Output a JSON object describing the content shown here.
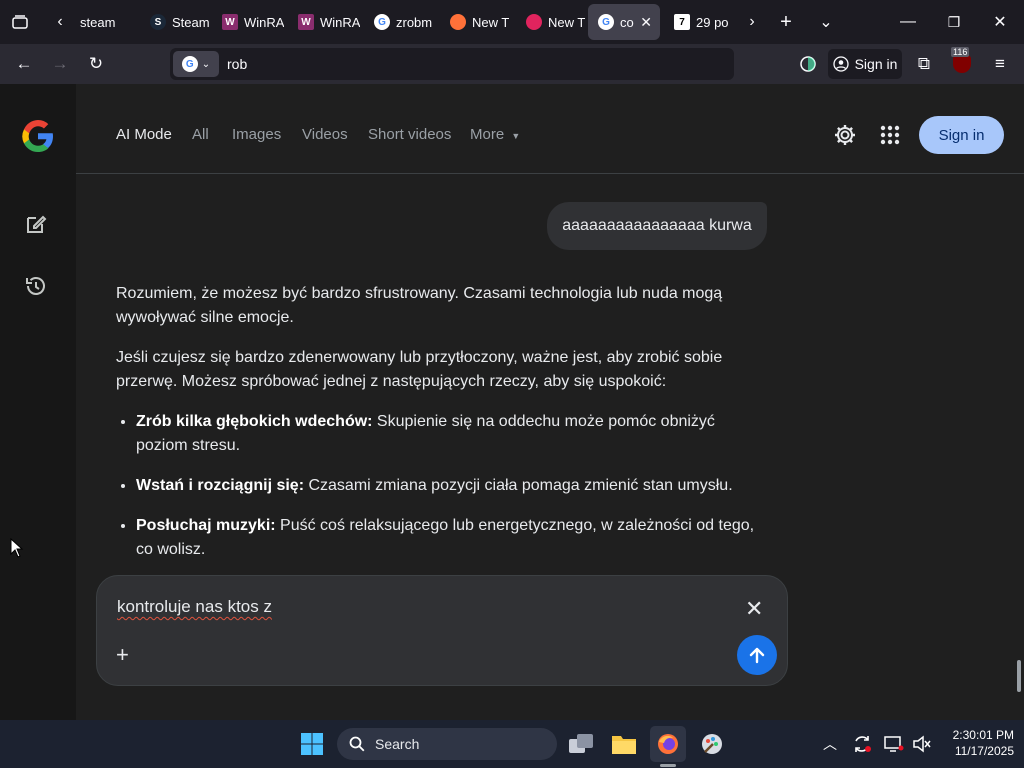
{
  "browser": {
    "tabs": [
      {
        "label": "steam",
        "icon": "back-icon"
      },
      {
        "label": "Steam",
        "icon": "steam-icon"
      },
      {
        "label": "WinRA",
        "icon": "winrar-icon"
      },
      {
        "label": "WinRA",
        "icon": "winrar-icon"
      },
      {
        "label": "zrobm",
        "icon": "google-icon"
      },
      {
        "label": "New T",
        "icon": "firefox-icon"
      },
      {
        "label": "New T",
        "icon": "firefox-icon"
      },
      {
        "label": "co",
        "icon": "google-icon",
        "active": true
      },
      {
        "label": "29 po",
        "icon": "wykop-icon"
      }
    ],
    "url_text": "rob",
    "signin_label": "Sign in",
    "extension_badge": "116"
  },
  "google": {
    "nav": [
      "AI Mode",
      "All",
      "Images",
      "Videos",
      "Short videos",
      "More"
    ],
    "signin_label": "Sign in"
  },
  "conversation": {
    "user_message": "aaaaaaaaaaaaaaaa kurwa",
    "paragraphs": [
      "Rozumiem, że możesz być bardzo sfrustrowany. Czasami technologia lub nuda mogą wywoływać silne emocje.",
      "Jeśli czujesz się bardzo zdenerwowany lub przytłoczony, ważne jest, aby zrobić sobie przerwę. Możesz spróbować jednej z następujących rzeczy, aby się uspokoić:"
    ],
    "tips": [
      {
        "title": "Zrób kilka głębokich wdechów:",
        "text": " Skupienie się na oddechu może pomóc obniżyć poziom stresu."
      },
      {
        "title": "Wstań i rozciągnij się:",
        "text": " Czasami zmiana pozycji ciała pomaga zmienić stan umysłu."
      },
      {
        "title": "Posłuchaj muzyki:",
        "text": " Puść coś relaksującego lub energetycznego, w zależności od tego, co wolisz."
      }
    ]
  },
  "composer": {
    "text": "kontroluje nas ktos z"
  },
  "taskbar": {
    "search_label": "Search",
    "time": "2:30:01 PM",
    "date": "11/17/2025"
  },
  "colors": {
    "accent": "#1a73e8",
    "signin_bg": "#a8c7fa"
  }
}
